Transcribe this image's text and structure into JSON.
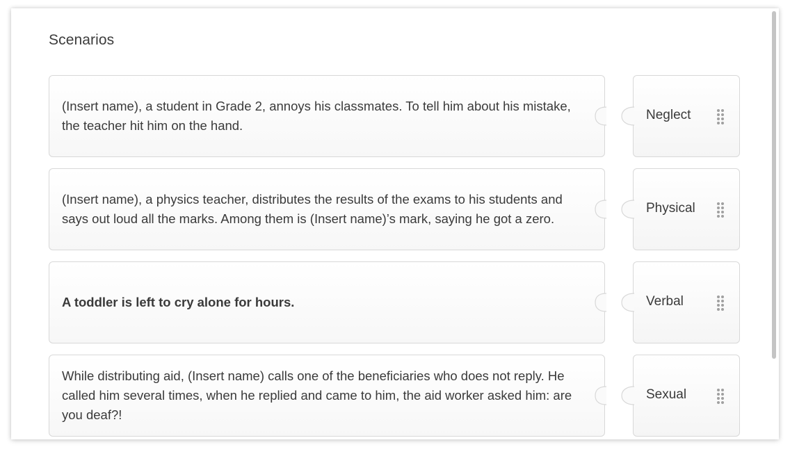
{
  "title": "Scenarios",
  "rows": [
    {
      "scenario": "(Insert name), a student in Grade 2, annoys his classmates. To tell him about his mistake, the teacher hit him on the hand.",
      "category": "Neglect"
    },
    {
      "scenario": "(Insert name), a physics teacher, distributes the results of the exams to his students and says out loud all the marks. Among them is (Insert name)’s mark, saying he got a zero.",
      "category": "Physical"
    },
    {
      "scenario": "A toddler is left to cry alone for hours.",
      "category": "Verbal"
    },
    {
      "scenario": "While distributing aid, (Insert name) calls one of the beneficiaries who does not reply. He called him several times, when he replied and came to him, the aid worker asked him: are you deaf?!",
      "category": "Sexual"
    }
  ],
  "icons": {
    "drag_handle": "drag-handle-icon"
  },
  "colors": {
    "border": "#d8d8d8",
    "text": "#3a3a3a",
    "grip": "#a0a0a0"
  }
}
